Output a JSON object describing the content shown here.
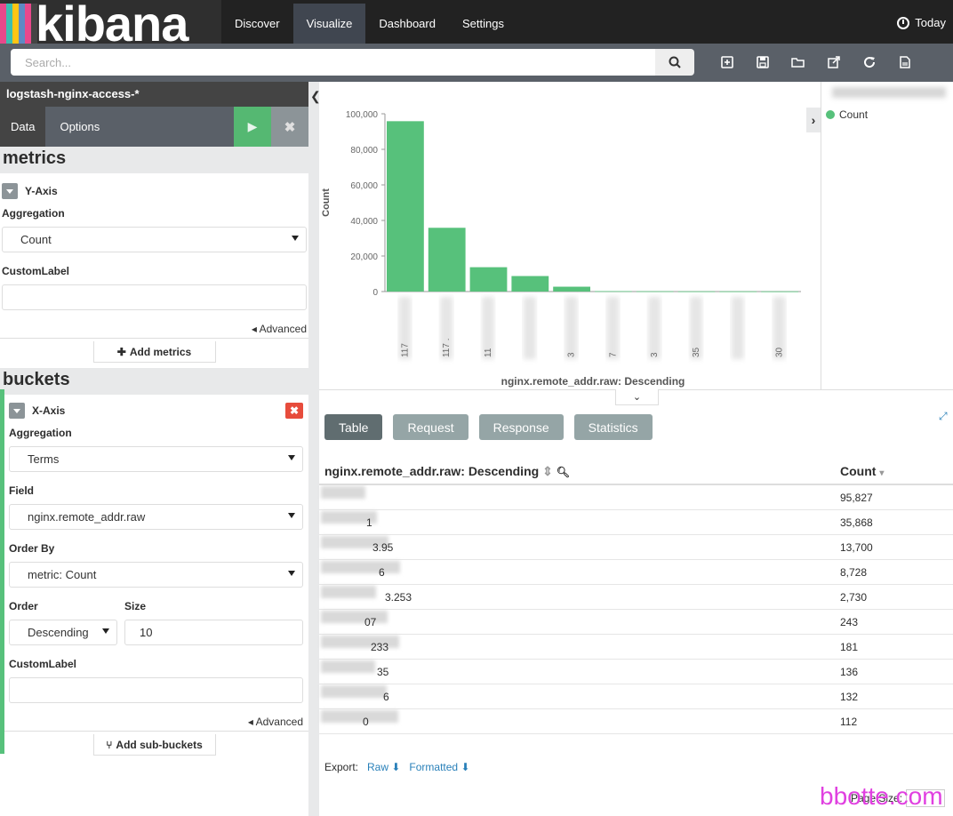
{
  "app": {
    "logo_text": "kibana",
    "stripe_colors": [
      "#e8488b",
      "#3cbeb1",
      "#fec514",
      "#5d8ac4",
      "#444"
    ]
  },
  "nav": {
    "items": [
      "Discover",
      "Visualize",
      "Dashboard",
      "Settings"
    ],
    "active": "Visualize",
    "time_label": "Today"
  },
  "search": {
    "placeholder": "Search..."
  },
  "sidebar": {
    "index_pattern": "logstash-nginx-access-*",
    "tabs": {
      "data": "Data",
      "options": "Options"
    },
    "metrics": {
      "title": "metrics",
      "agg_title": "Y-Axis",
      "aggregation_label": "Aggregation",
      "aggregation_value": "Count",
      "custom_label": "CustomLabel",
      "advanced": "Advanced",
      "add_button": "Add metrics"
    },
    "buckets": {
      "title": "buckets",
      "agg_title": "X-Axis",
      "aggregation_label": "Aggregation",
      "aggregation_value": "Terms",
      "field_label": "Field",
      "field_value": "nginx.remote_addr.raw",
      "order_by_label": "Order By",
      "order_by_value": "metric: Count",
      "order_label": "Order",
      "order_value": "Descending",
      "size_label": "Size",
      "size_value": "10",
      "custom_label": "CustomLabel",
      "advanced": "Advanced",
      "add_button": "Add sub-buckets"
    }
  },
  "chart_data": {
    "type": "bar",
    "categories": [
      "117",
      "117",
      "11",
      "",
      "",
      "",
      "",
      "",
      "",
      ""
    ],
    "tick_label_fragments": [
      "117",
      "117 .",
      "11",
      "",
      "3",
      "7",
      "3",
      "35",
      "",
      "30"
    ],
    "values": [
      95827,
      35868,
      13700,
      8728,
      2730,
      243,
      181,
      136,
      132,
      112
    ],
    "xlabel": "nginx.remote_addr.raw: Descending",
    "ylabel": "Count",
    "ylim": [
      0,
      100000
    ],
    "yticks": [
      "100,000",
      "80,000",
      "60,000",
      "40,000",
      "20,000",
      "0"
    ],
    "legend": [
      "Count"
    ],
    "color": "#57c17b"
  },
  "spy": {
    "tabs": [
      "Table",
      "Request",
      "Response",
      "Statistics"
    ],
    "active": "Table",
    "table": {
      "headers": [
        "nginx.remote_addr.raw: Descending",
        "Count"
      ],
      "rows": [
        {
          "ip": "",
          "count": "95,827"
        },
        {
          "ip": "1",
          "count": "35,868"
        },
        {
          "ip": "3.95",
          "count": "13,700"
        },
        {
          "ip": "6",
          "count": "8,728"
        },
        {
          "ip": "3.253",
          "count": "2,730"
        },
        {
          "ip": "07",
          "count": "243"
        },
        {
          "ip": "233",
          "count": "181"
        },
        {
          "ip": "35",
          "count": "136"
        },
        {
          "ip": "6",
          "count": "132"
        },
        {
          "ip": "0",
          "count": "112"
        }
      ]
    },
    "export_label": "Export:",
    "export_raw": "Raw",
    "export_formatted": "Formatted",
    "page_size_label": "Page Size:"
  },
  "watermark": "bbotte.com"
}
